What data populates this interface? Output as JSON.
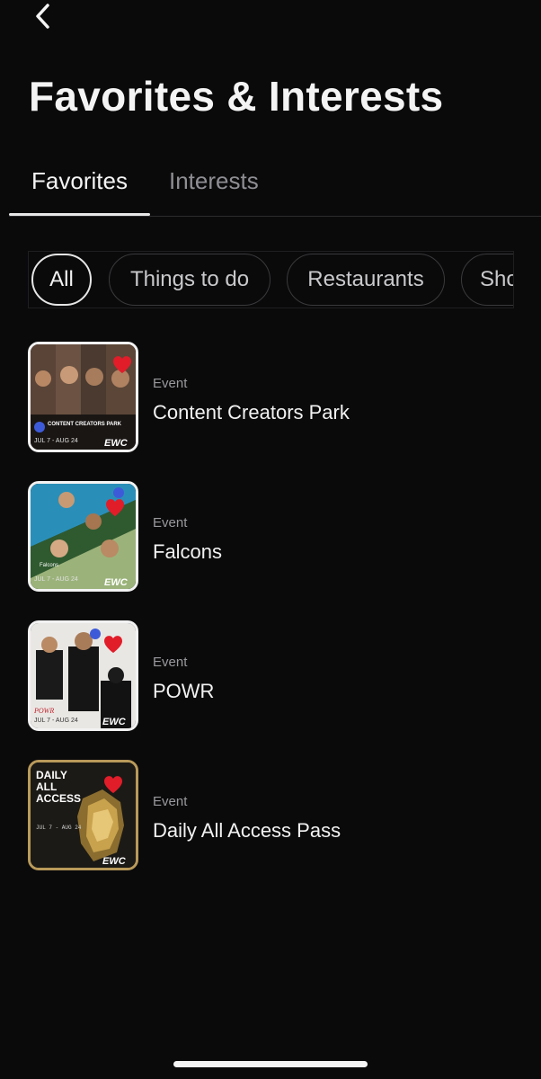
{
  "header": {
    "back_icon": "chevron-left-icon",
    "title": "Favorites & Interests"
  },
  "tabs": [
    {
      "label": "Favorites",
      "active": true
    },
    {
      "label": "Interests",
      "active": false
    }
  ],
  "filters": {
    "chips": [
      {
        "label": "All",
        "active": true
      },
      {
        "label": "Things to do",
        "active": false
      },
      {
        "label": "Restaurants",
        "active": false
      },
      {
        "label": "Sho",
        "active": false
      }
    ]
  },
  "favorites": [
    {
      "category": "Event",
      "title": "Content Creators Park",
      "thumb_dates": "JUL 7 - AUG 24",
      "thumb_brand": "EWC",
      "thumb_caption": "CONTENT CREATORS PARK"
    },
    {
      "category": "Event",
      "title": "Falcons",
      "thumb_dates": "JUL 7 - AUG 24",
      "thumb_brand": "EWC",
      "thumb_caption": "Falcons"
    },
    {
      "category": "Event",
      "title": "POWR",
      "thumb_dates": "JUL 7 - AUG 24",
      "thumb_brand": "EWC",
      "thumb_caption": "POWR"
    },
    {
      "category": "Event",
      "title": "Daily All Access Pass",
      "thumb_dates": "JUL 7 - AUG 24",
      "thumb_brand": "EWC",
      "thumb_caption": "DAILY ALL ACCESS"
    }
  ],
  "colors": {
    "background": "#0a0a0b",
    "heart": "#e11d2a",
    "muted_text": "#9a9a9e",
    "gold": "#b99a5a"
  }
}
